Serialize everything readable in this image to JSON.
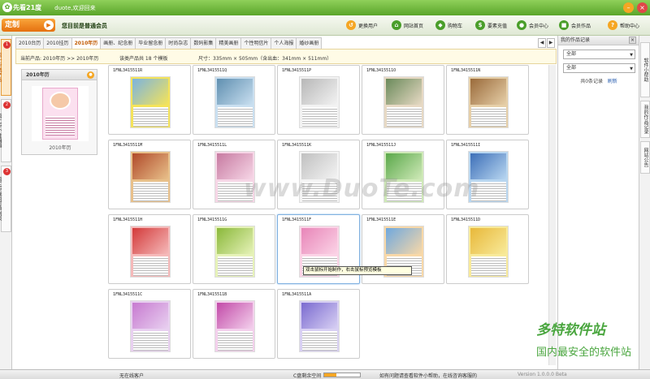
{
  "titlebar": {
    "app_name": "先看21度",
    "welcome": "duote,欢迎回来"
  },
  "toolbar": {
    "custom_label": "定制",
    "member_text": "您目前是普通会员",
    "menu": [
      {
        "label": "更换用户",
        "color": "#f5a623",
        "glyph": "↺"
      },
      {
        "label": "网站首页",
        "color": "#4a9e2a",
        "glyph": "⌂"
      },
      {
        "label": "购物车",
        "color": "#4a9e2a",
        "glyph": "◆"
      },
      {
        "label": "要素充值",
        "color": "#4a9e2a",
        "glyph": "$"
      },
      {
        "label": "会员中心",
        "color": "#4a9e2a",
        "glyph": "●"
      },
      {
        "label": "会员作品",
        "color": "#4a9e2a",
        "glyph": "■"
      },
      {
        "label": "帮助中心",
        "color": "#f5a623",
        "glyph": "?"
      }
    ]
  },
  "left_tabs": [
    {
      "num": "1",
      "label": "第一步选产品",
      "active": true
    },
    {
      "num": "2",
      "label": "第二步个性编辑",
      "active": false
    },
    {
      "num": "3",
      "label": "第三步我的订单列表",
      "active": false
    }
  ],
  "category_tabs": [
    "2010台历",
    "2010挂历",
    "2010年历",
    "画册、纪念册",
    "毕业留念册",
    "时尚杂志",
    "数码影集",
    "精美画册",
    "个性明信片",
    "个人海报",
    "婚纱画册"
  ],
  "active_tab": "2010年历",
  "catbar": {
    "current": "当前产品: 2010年历 >> 2010年历",
    "count": "该类产品共 18 个模板",
    "size": "尺寸：335mm × 505mm（含出血：341mm × 511mm）"
  },
  "preview": {
    "title": "2010年历",
    "caption": "2010年历"
  },
  "templates": [
    {
      "code": "1FNL3415511R",
      "c1": "#f4e35a",
      "c2": "#7bb3df"
    },
    {
      "code": "1FNL3415511Q",
      "c1": "#c9dff0",
      "c2": "#5f8fb0"
    },
    {
      "code": "1FNL3415511P",
      "c1": "#f2f2f2",
      "c2": "#b7b7b7"
    },
    {
      "code": "1FNL3415511O",
      "c1": "#e7d9c4",
      "c2": "#6a8a5a"
    },
    {
      "code": "1FNL3415511N",
      "c1": "#e6cfa8",
      "c2": "#9a6a3a"
    },
    {
      "code": "1FNL3415511M",
      "c1": "#e8c08a",
      "c2": "#b04a2a"
    },
    {
      "code": "1FNL3415511L",
      "c1": "#f6d6e6",
      "c2": "#c77aa1"
    },
    {
      "code": "1FNL3415511K",
      "c1": "#f4f4f4",
      "c2": "#c0c0c0"
    },
    {
      "code": "1FNL3415511J",
      "c1": "#cfe9b8",
      "c2": "#5aa84a"
    },
    {
      "code": "1FNL3415511I",
      "c1": "#b8d6f0",
      "c2": "#3d6fb8"
    },
    {
      "code": "1FNL3415511H",
      "c1": "#f5b9b9",
      "c2": "#d33a3a"
    },
    {
      "code": "1FNL3415511G",
      "c1": "#e6f2b8",
      "c2": "#8ab83a"
    },
    {
      "code": "1FNL3415511F",
      "c1": "#fbd3e6",
      "c2": "#e885b8"
    },
    {
      "code": "1FNL3415511E",
      "c1": "#f8d8a8",
      "c2": "#6fa8de"
    },
    {
      "code": "1FNL3415511D",
      "c1": "#f8ea9a",
      "c2": "#e8b83a"
    },
    {
      "code": "1FNL3415511C",
      "c1": "#e8d0f0",
      "c2": "#c77ad0"
    },
    {
      "code": "1FNL3415511B",
      "c1": "#f3d0ec",
      "c2": "#c24aa8"
    },
    {
      "code": "1FNL3415511A",
      "c1": "#d8d0f3",
      "c2": "#7a6ad0"
    }
  ],
  "tooltip": "双击鼠标开始制作，右击鼠标预览模板",
  "watermark": "www.DuoTe.com",
  "watermark2": {
    "brand": "多特软件站",
    "sub": "国内最安全的软件站"
  },
  "right_panel": {
    "title": "我的作品记录",
    "select1": "全部",
    "select2": "全部",
    "info": "共0条记录",
    "refresh": "刷新"
  },
  "right_tabs": [
    "软件小帮助",
    "我的作品记录",
    "网站公告"
  ],
  "status": {
    "left": "无在线客户",
    "space_label": "C盘剩余空间",
    "space_fill": 0.35,
    "help": "如有问题请查看软件小帮助，在线咨询客服的",
    "version": "Version 1.0.0.0 Beta"
  }
}
